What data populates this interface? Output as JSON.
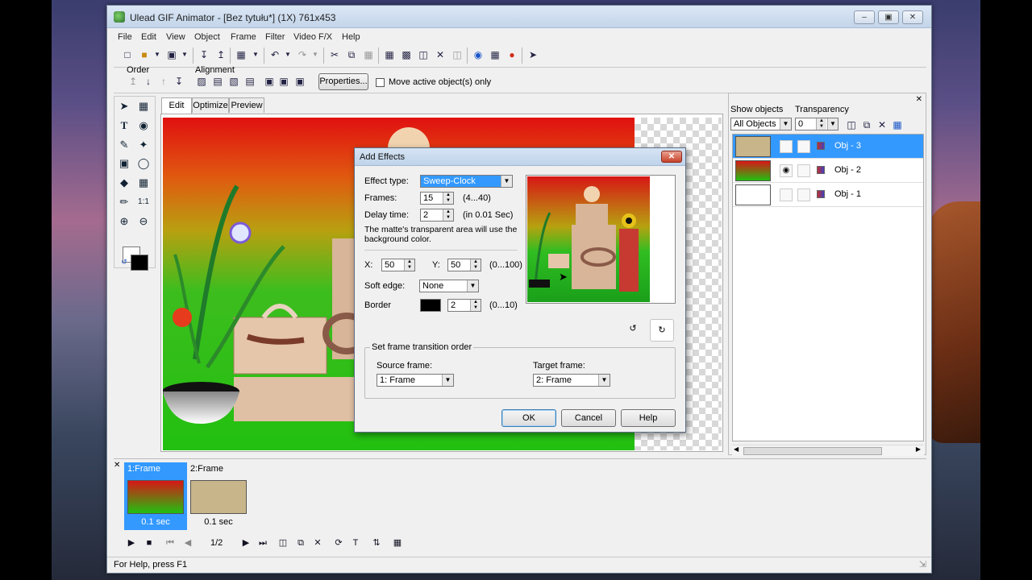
{
  "window": {
    "title": "Ulead GIF Animator - [Bez tytułu*] (1X) 761x453",
    "minimize_icon": "minimize-icon",
    "maximize_icon": "maximize-icon",
    "close_icon": "close-icon"
  },
  "menu": [
    "File",
    "Edit",
    "View",
    "Object",
    "Frame",
    "Filter",
    "Video F/X",
    "Help"
  ],
  "properties": {
    "order_label": "Order",
    "alignment_label": "Alignment",
    "properties_button": "Properties...",
    "move_active_label": "Move active object(s) only"
  },
  "tabs": [
    "Edit",
    "Optimize",
    "Preview"
  ],
  "dialog": {
    "title": "Add Effects",
    "effect_type_label": "Effect type:",
    "effect_type_value": "Sweep-Clock",
    "frames_label": "Frames:",
    "frames_value": "15",
    "frames_range": "(4...40)",
    "delay_label": "Delay time:",
    "delay_value": "2",
    "delay_unit": "(in 0.01 Sec)",
    "matte_note": "The matte's transparent area will use the background color.",
    "x_label": "X:",
    "x_value": "50",
    "y_label": "Y:",
    "y_value": "50",
    "xy_range": "(0...100)",
    "soft_edge_label": "Soft edge:",
    "soft_edge_value": "None",
    "border_label": "Border",
    "border_color": "#000000",
    "border_value": "2",
    "border_range": "(0...10)",
    "transition_group": "Set frame transition order",
    "source_label": "Source frame:",
    "source_value": "1: Frame",
    "target_label": "Target frame:",
    "target_value": "2: Frame",
    "ok": "OK",
    "cancel": "Cancel",
    "help": "Help"
  },
  "objects": {
    "show_label": "Show objects",
    "show_value": "All Objects",
    "transparency_label": "Transparency",
    "transparency_value": "0",
    "rows": [
      {
        "name": "Obj - 3",
        "selected": true
      },
      {
        "name": "Obj - 2",
        "selected": false
      },
      {
        "name": "Obj - 1",
        "selected": false
      }
    ]
  },
  "frames": [
    {
      "label": "1:Frame",
      "delay": "0.1 sec",
      "selected": true
    },
    {
      "label": "2:Frame",
      "delay": "0.1 sec",
      "selected": false
    }
  ],
  "playback": {
    "counter": "1/2"
  },
  "status": {
    "text": "For Help, press F1"
  },
  "colors": {
    "selection": "#3399ff",
    "fg": "#ffffff",
    "bg": "#000000"
  }
}
